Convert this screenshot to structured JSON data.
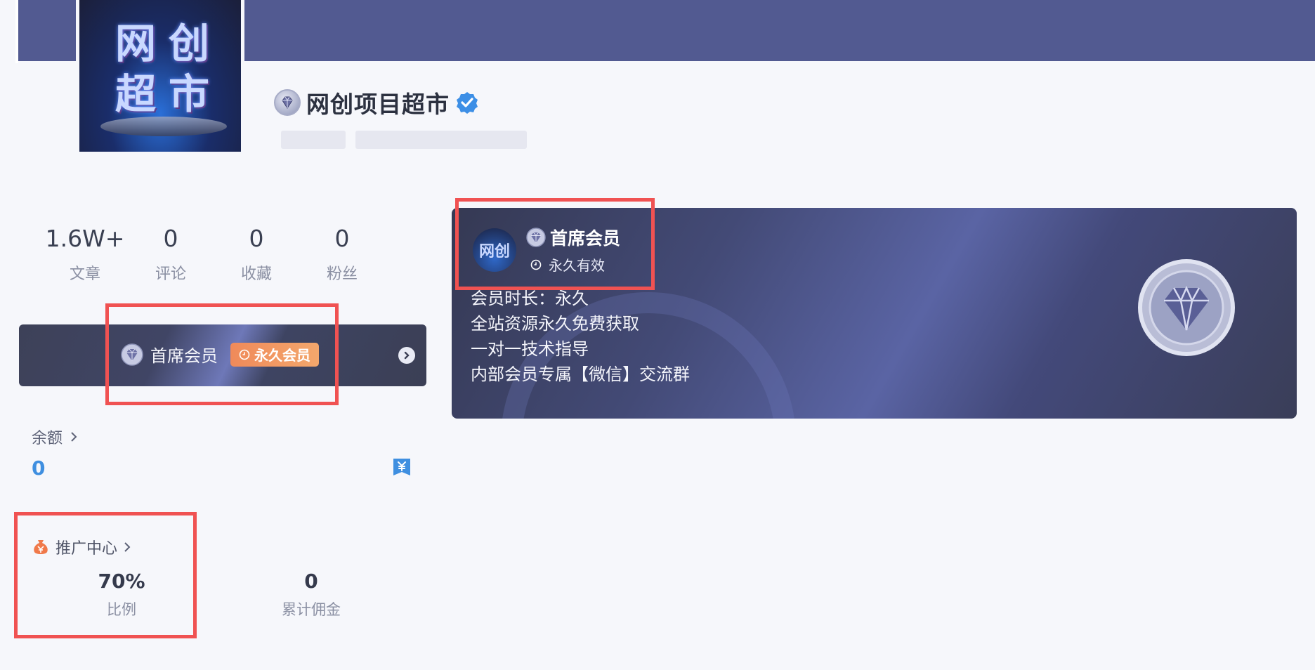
{
  "profile": {
    "avatar_text": [
      "网",
      "创",
      "超",
      "市"
    ],
    "name": "网创项目超市",
    "icons": {
      "badge": "gem-icon",
      "verified": "verified-check-icon"
    }
  },
  "stats": [
    {
      "value": "1.6W+",
      "label": "文章"
    },
    {
      "value": "0",
      "label": "评论"
    },
    {
      "value": "0",
      "label": "收藏"
    },
    {
      "value": "0",
      "label": "粉丝"
    }
  ],
  "member_bar": {
    "label": "首席会员",
    "tag": "永久会员",
    "icons": {
      "gem": "gem-icon",
      "tag": "clock-icon",
      "arrow": "chevron-right-circle-icon"
    }
  },
  "balance": {
    "label": "余额",
    "value": "0",
    "icon": "wallet-yen-icon"
  },
  "promotion": {
    "label": "推广中心",
    "ratio_value": "70%",
    "ratio_label": "比例",
    "commission_value": "0",
    "commission_label": "累计佣金",
    "icon": "money-bag-icon"
  },
  "vip_card": {
    "avatar_text": "网创",
    "title": "首席会员",
    "validity": "永久有效",
    "benefits": [
      "会员时长：永久",
      "全站资源永久免费获取",
      "一对一技术指导",
      "内部会员专属【微信】交流群"
    ],
    "icons": {
      "gem": "gem-icon",
      "validity": "clock-icon",
      "big": "large-gem-emblem-icon"
    }
  },
  "colors": {
    "banner": "#525a91",
    "accent_blue": "#3f8fe0",
    "tag_orange": "#f08a5a",
    "highlight_red": "#f05252"
  }
}
